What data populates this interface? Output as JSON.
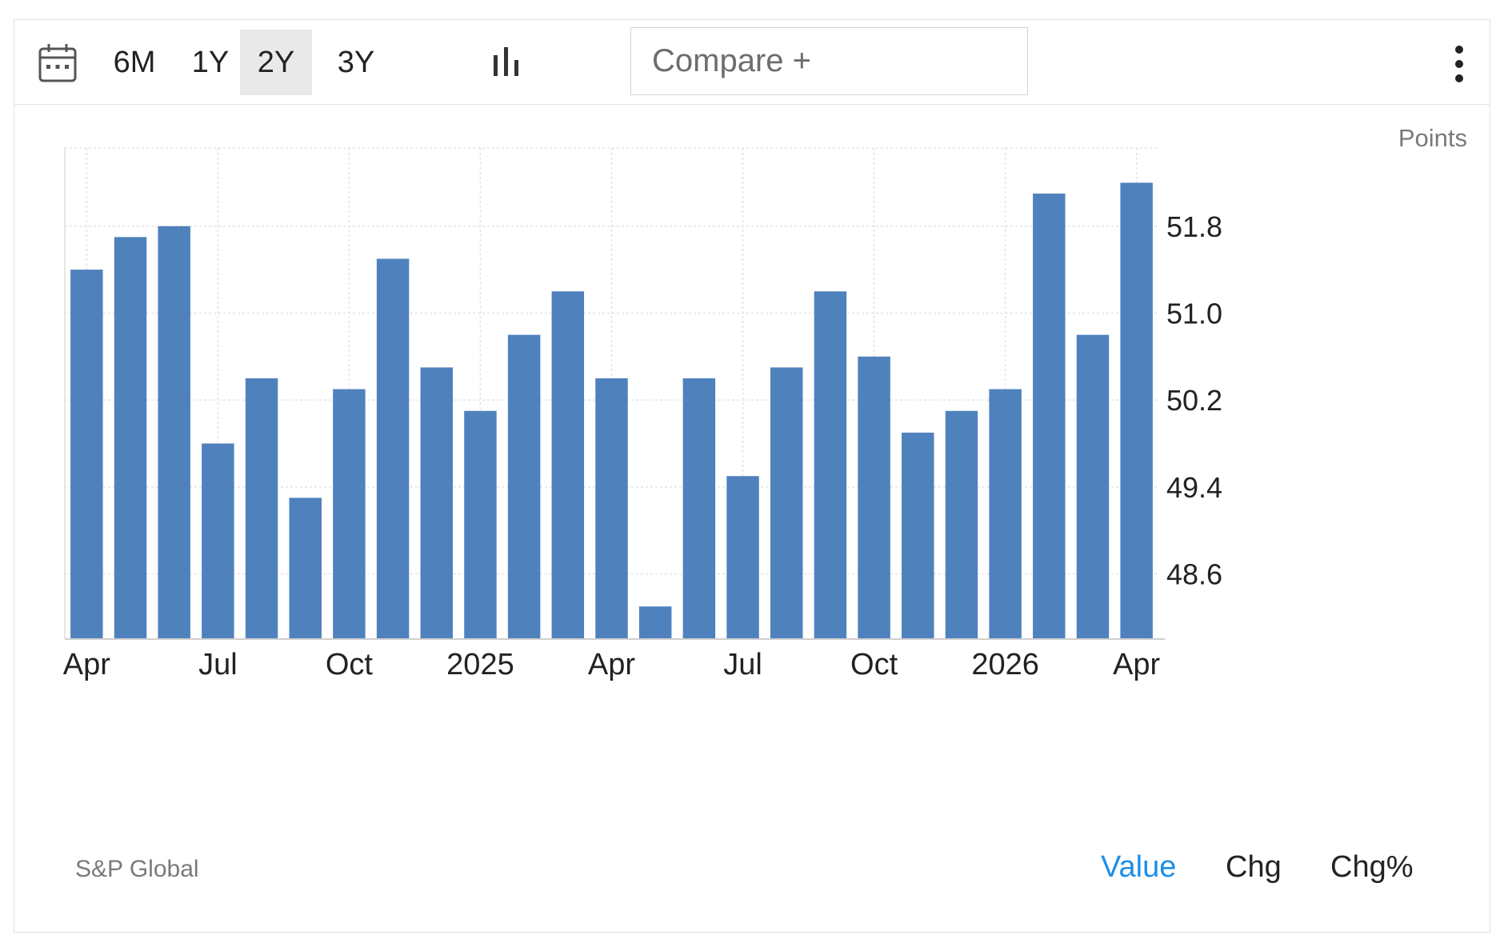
{
  "toolbar": {
    "calendar_icon": "calendar-icon",
    "ranges": [
      "6M",
      "1Y",
      "2Y",
      "3Y"
    ],
    "active_range": "2Y",
    "chart_type_icon": "bar-chart-icon",
    "compare_label": "Compare +",
    "menu_icon": "kebab-menu-icon"
  },
  "units_label": "Points",
  "source_label": "S&P Global",
  "view_tabs": {
    "value": "Value",
    "chg": "Chg",
    "chg_pct": "Chg%",
    "active": "Value"
  },
  "colors": {
    "bar": "#4f81bd",
    "active_tab": "#1e8fe6",
    "grid": "#e3e3e3",
    "axis_text": "#222222",
    "muted_text": "#7a7a7a"
  },
  "chart_data": {
    "type": "bar",
    "categories": [
      "Apr 2024",
      "May 2024",
      "Jun 2024",
      "Jul 2024",
      "Aug 2024",
      "Sep 2024",
      "Oct 2024",
      "Nov 2024",
      "Dec 2024",
      "Jan 2025",
      "Feb 2025",
      "Mar 2025",
      "Apr 2025",
      "May 2025",
      "Jun 2025",
      "Jul 2025",
      "Aug 2025",
      "Sep 2025",
      "Oct 2025",
      "Nov 2025",
      "Dec 2025",
      "Jan 2026",
      "Feb 2026",
      "Mar 2026",
      "Apr 2026"
    ],
    "values": [
      51.4,
      51.7,
      51.8,
      49.8,
      50.4,
      49.3,
      50.3,
      51.5,
      50.5,
      50.1,
      50.8,
      51.2,
      50.4,
      48.3,
      50.4,
      49.5,
      50.5,
      51.2,
      50.6,
      49.9,
      50.1,
      50.3,
      52.1,
      50.8,
      52.2
    ],
    "x_tick_labels": [
      {
        "label": "Apr",
        "category": "Apr 2024"
      },
      {
        "label": "Jul",
        "category": "Jul 2024"
      },
      {
        "label": "Oct",
        "category": "Oct 2024"
      },
      {
        "label": "2025",
        "category": "Jan 2025"
      },
      {
        "label": "Apr",
        "category": "Apr 2025"
      },
      {
        "label": "Jul",
        "category": "Jul 2025"
      },
      {
        "label": "Oct",
        "category": "Oct 2025"
      },
      {
        "label": "2026",
        "category": "Jan 2026"
      },
      {
        "label": "Apr",
        "category": "Apr 2026"
      }
    ],
    "y_ticks": [
      "48.6",
      "49.4",
      "50.2",
      "51.0",
      "51.8"
    ],
    "ylim": [
      48.0,
      52.52
    ],
    "yaxis_position": "right",
    "grid": true,
    "ylabel": "Points"
  }
}
